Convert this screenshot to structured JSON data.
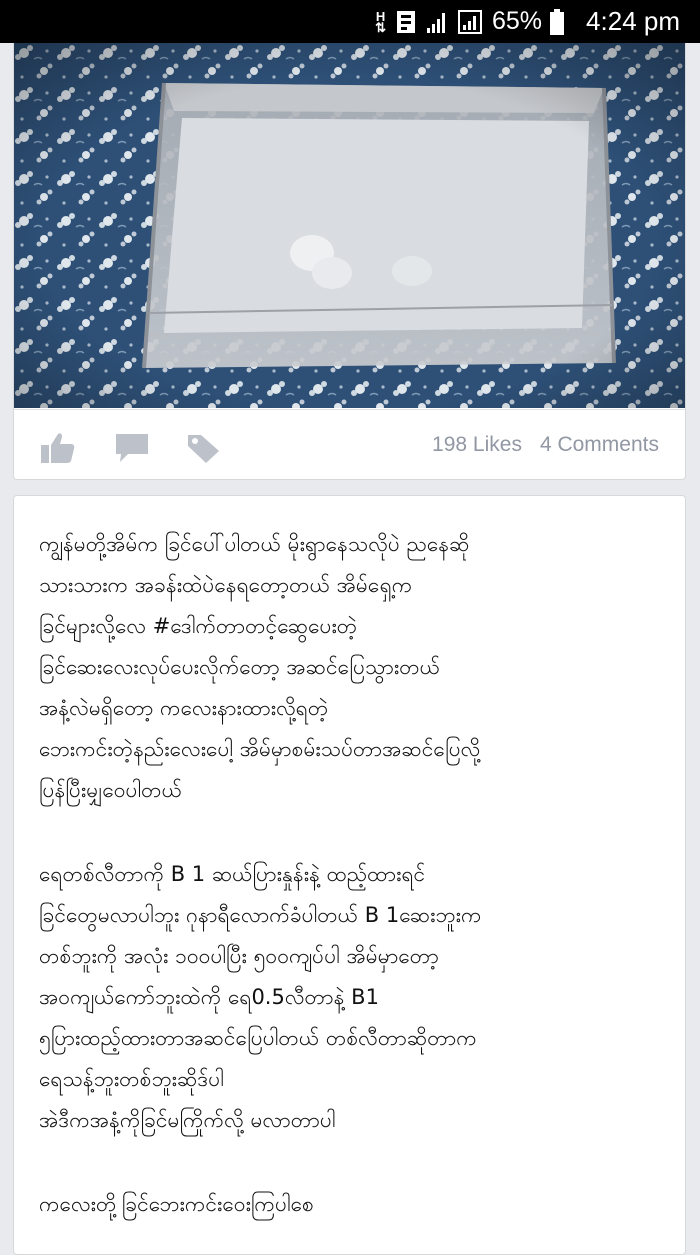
{
  "status_bar": {
    "network_label": "H",
    "battery_percent": "65%",
    "time": "4:24 pm",
    "icons": [
      "data-arrows-icon",
      "notification-icon",
      "signal-icon",
      "signal-icon",
      "battery-icon"
    ]
  },
  "post_photo": {
    "colors": {
      "cloth": "#2d4f78",
      "container": "#b9bcc0",
      "water": "#d6d9de"
    }
  },
  "actions": {
    "like_icon": "thumbs-up-icon",
    "comment_icon": "comment-icon",
    "tag_icon": "tag-icon",
    "likes": "198 Likes",
    "comments": "4 Comments"
  },
  "post": {
    "paragraphs": [
      [
        "ကျွန်မတို့အိမ်က ခြင်ပေါ်ပါတယ် မိုးရွာနေသလိုပဲ ညနေဆို",
        "သားသားက အခန်းထဲပဲနေရတော့တယ် အိမ်ရှေ့က",
        "ခြင်များလို့လေ #ဒေါက်တာတင့်ဆွေပေးတဲ့",
        "ခြင်ဆေးလေးလုပ်ပေးလိုက်တော့ အဆင်ပြေသွားတယ်",
        "အနံ့လဲမရှိတော့ ကလေးနားထားလို့ရတဲ့",
        "ဘေးကင်းတဲ့နည်းလေးပေါ့ အိမ်မှာစမ်းသပ်တာအဆင်ပြေလို့",
        "ပြန်ပြီးမျှဝေပါတယ်"
      ],
      [
        "ရေတစ်လီတာကို B 1 ဆယ်ပြားနှုန်းနဲ့ ထည့်ထားရင်",
        "ခြင်တွေမလာပါဘူး ဂုနာရီလောက်ခံပါတယ် B 1ဆေးဘူးက",
        "တစ်ဘူးကို အလုံး ၁၀၀ပါပြီး ၅၀၀ကျပ်ပါ အိမ်မှာတော့",
        "အဝကျယ်ကော်ဘူးထဲကို ရေ0.5လီတာနဲ့ B1",
        "၅ပြားထည့်ထားတာအဆင်ပြေပါတယ် တစ်လီတာဆိုတာက",
        "ရေသန့်ဘူးတစ်ဘူးဆိုဒ်ပါ",
        "အဲဒီကအနံ့ကိုခြင်မကြိုက်လို့ မလာတာပါ"
      ],
      [
        "ကလေးတို့ခြင်ဘေးကင်းဝေးကြပါစေ"
      ]
    ]
  }
}
